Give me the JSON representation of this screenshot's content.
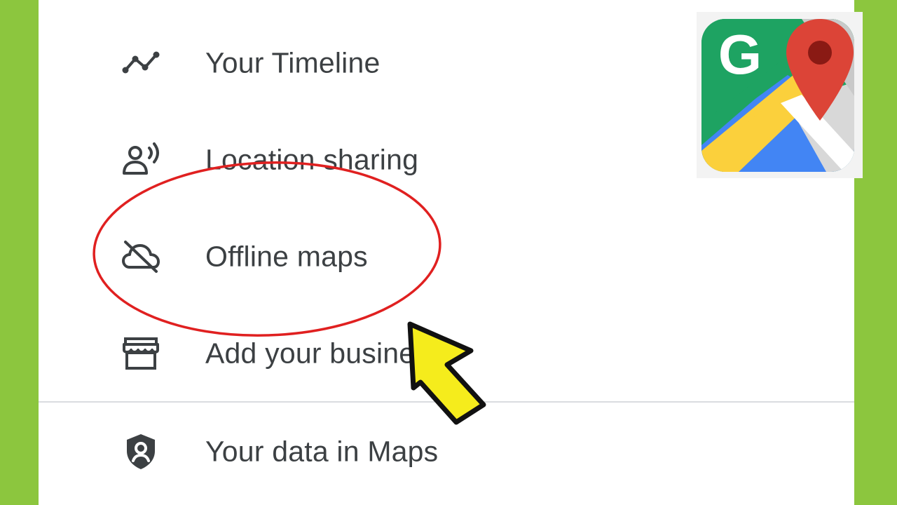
{
  "menu": {
    "items": [
      {
        "label": "Your Timeline",
        "icon": "timeline-icon"
      },
      {
        "label": "Location sharing",
        "icon": "location-sharing-icon"
      },
      {
        "label": "Offline maps",
        "icon": "cloud-off-icon"
      },
      {
        "label": "Add your business",
        "icon": "storefront-icon"
      },
      {
        "label": "Your data in Maps",
        "icon": "shield-person-icon"
      }
    ]
  },
  "colors": {
    "background": "#8cc63e",
    "panel": "#ffffff",
    "text": "#3c4043",
    "highlight_circle": "#e02020",
    "cursor_fill": "#f5ec1c"
  },
  "logo": {
    "icon": "google-maps-logo",
    "letter": "G"
  }
}
